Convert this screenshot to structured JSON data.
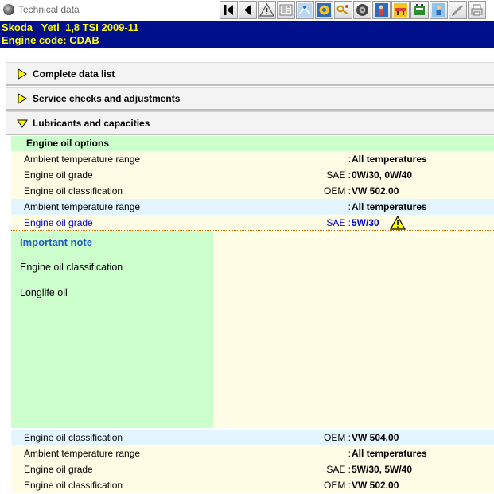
{
  "window": {
    "title": "Technical data"
  },
  "toolbar": {
    "buttons": [
      {
        "name": "first-icon"
      },
      {
        "name": "back-icon"
      },
      {
        "name": "warning-icon"
      },
      {
        "name": "document-icon"
      },
      {
        "name": "lift-icon"
      },
      {
        "name": "wheel-gear-icon"
      },
      {
        "name": "key-icon"
      },
      {
        "name": "tire-icon"
      },
      {
        "name": "mechanic-icon"
      },
      {
        "name": "car-lift-icon"
      },
      {
        "name": "battery-icon"
      },
      {
        "name": "person-icon"
      },
      {
        "name": "pen-icon"
      },
      {
        "name": "print-icon"
      }
    ]
  },
  "vehicle": {
    "line1": "Skoda   Yeti  1,8 TSI 2009-11",
    "line2": "Engine code: CDAB"
  },
  "sections": [
    {
      "label": "Complete data list"
    },
    {
      "label": "Service checks and adjustments"
    },
    {
      "label": "Lubricants and capacities"
    }
  ],
  "group": {
    "title": "Engine oil options"
  },
  "rows_top": [
    {
      "label": "Ambient temperature range",
      "prefix": ":",
      "value": "All temperatures"
    },
    {
      "label": "Engine oil grade",
      "prefix": "SAE :",
      "value": "0W/30, 0W/40"
    },
    {
      "label": "Engine oil classification",
      "prefix": "OEM :",
      "value": "VW 502.00"
    },
    {
      "label": "Ambient temperature range",
      "prefix": ":",
      "value": "All temperatures"
    },
    {
      "label": "Engine oil grade",
      "prefix": "SAE :",
      "value": "5W/30"
    }
  ],
  "note": {
    "title": "Important note",
    "line1": "Engine oil classification",
    "line2": "Longlife oil"
  },
  "rows_bottom": [
    {
      "label": "Engine oil classification",
      "prefix": "OEM :",
      "value": "VW 504.00"
    },
    {
      "label": "Ambient temperature range",
      "prefix": ":",
      "value": "All temperatures"
    },
    {
      "label": "Engine oil grade",
      "prefix": "SAE :",
      "value": "5W/30, 5W/40"
    },
    {
      "label": "Engine oil classification",
      "prefix": "OEM :",
      "value": "VW 502.00"
    }
  ],
  "colors": {
    "header_bg": "#000f8c",
    "header_text": "#ffff00",
    "subhead_bg": "#ccffcc",
    "row_bg": "#fffde6",
    "row_highlight_bg": "#e3f5ff",
    "link_blue": "#0000cc",
    "note_title": "#1f5fbf"
  }
}
